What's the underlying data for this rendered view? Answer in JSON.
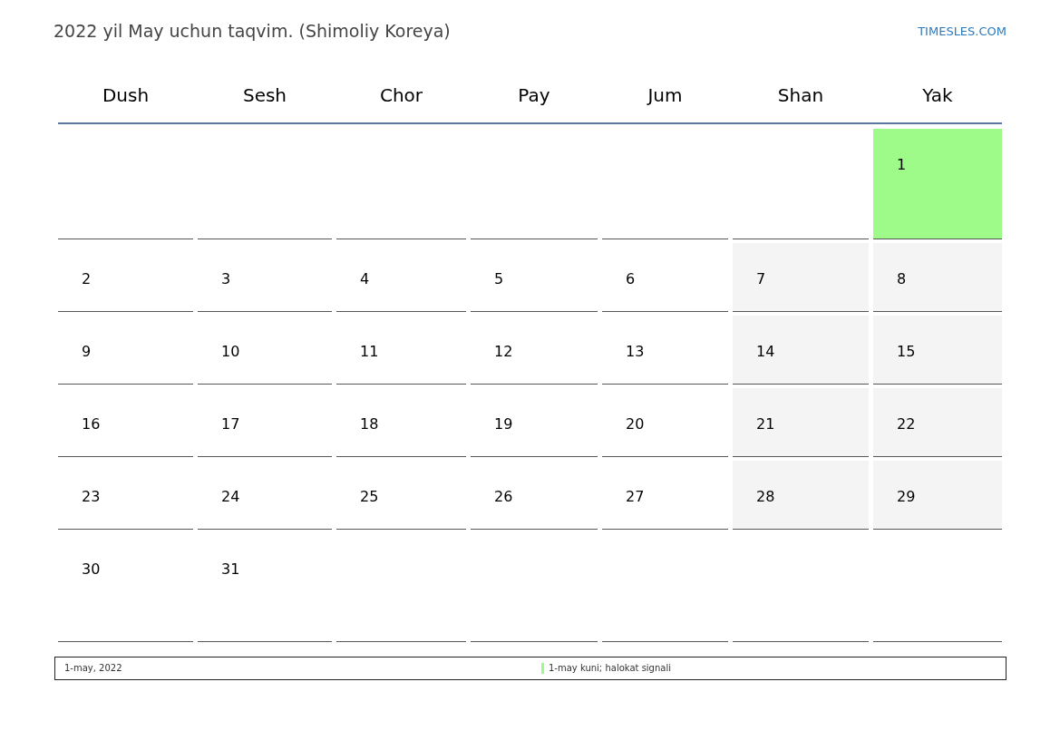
{
  "title": "2022 yil May uchun taqvim. (Shimoliy Koreya)",
  "site_link": "TIMESLES.COM",
  "weekdays": [
    "Dush",
    "Sesh",
    "Chor",
    "Pay",
    "Jum",
    "Shan",
    "Yak"
  ],
  "weeks": [
    [
      {
        "kind": "blank"
      },
      {
        "kind": "blank"
      },
      {
        "kind": "blank"
      },
      {
        "kind": "blank"
      },
      {
        "kind": "blank"
      },
      {
        "kind": "blank"
      },
      {
        "kind": "day",
        "day": "1",
        "holiday": true
      }
    ],
    [
      {
        "kind": "day",
        "day": "2",
        "holiday": false
      },
      {
        "kind": "day",
        "day": "3",
        "holiday": false
      },
      {
        "kind": "day",
        "day": "4",
        "holiday": false
      },
      {
        "kind": "day",
        "day": "5",
        "holiday": false
      },
      {
        "kind": "day",
        "day": "6",
        "holiday": false
      },
      {
        "kind": "day",
        "day": "7",
        "holiday": false
      },
      {
        "kind": "day",
        "day": "8",
        "holiday": false
      }
    ],
    [
      {
        "kind": "day",
        "day": "9",
        "holiday": false
      },
      {
        "kind": "day",
        "day": "10",
        "holiday": false
      },
      {
        "kind": "day",
        "day": "11",
        "holiday": false
      },
      {
        "kind": "day",
        "day": "12",
        "holiday": false
      },
      {
        "kind": "day",
        "day": "13",
        "holiday": false
      },
      {
        "kind": "day",
        "day": "14",
        "holiday": false
      },
      {
        "kind": "day",
        "day": "15",
        "holiday": false
      }
    ],
    [
      {
        "kind": "day",
        "day": "16",
        "holiday": false
      },
      {
        "kind": "day",
        "day": "17",
        "holiday": false
      },
      {
        "kind": "day",
        "day": "18",
        "holiday": false
      },
      {
        "kind": "day",
        "day": "19",
        "holiday": false
      },
      {
        "kind": "day",
        "day": "20",
        "holiday": false
      },
      {
        "kind": "day",
        "day": "21",
        "holiday": false
      },
      {
        "kind": "day",
        "day": "22",
        "holiday": false
      }
    ],
    [
      {
        "kind": "day",
        "day": "23",
        "holiday": false
      },
      {
        "kind": "day",
        "day": "24",
        "holiday": false
      },
      {
        "kind": "day",
        "day": "25",
        "holiday": false
      },
      {
        "kind": "day",
        "day": "26",
        "holiday": false
      },
      {
        "kind": "day",
        "day": "27",
        "holiday": false
      },
      {
        "kind": "day",
        "day": "28",
        "holiday": false
      },
      {
        "kind": "day",
        "day": "29",
        "holiday": false
      }
    ],
    [
      {
        "kind": "day",
        "day": "30",
        "holiday": false
      },
      {
        "kind": "day",
        "day": "31",
        "holiday": false
      },
      {
        "kind": "blank"
      },
      {
        "kind": "blank"
      },
      {
        "kind": "blank"
      },
      {
        "kind": "blank"
      },
      {
        "kind": "blank"
      }
    ]
  ],
  "holidays": [
    {
      "date": "1-may, 2022",
      "name": "1-may kuni; halokat signali",
      "color": "#9efb8a"
    }
  ]
}
